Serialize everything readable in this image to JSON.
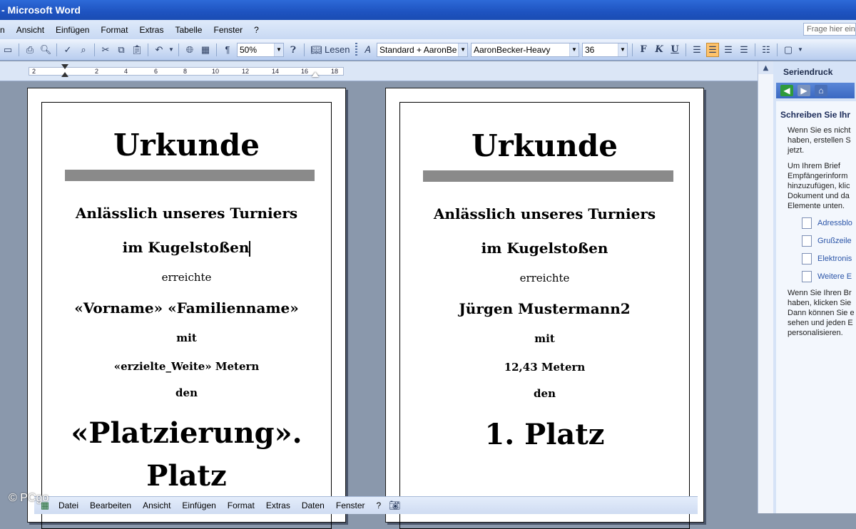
{
  "window": {
    "title": "- Microsoft Word"
  },
  "menu": [
    "n",
    "Ansicht",
    "Einfügen",
    "Format",
    "Extras",
    "Tabelle",
    "Fenster",
    "?"
  ],
  "help_placeholder": "Frage hier ein",
  "toolbar": {
    "zoom": "50%",
    "read_label": "Lesen",
    "style": "Standard + AaronBe",
    "font": "AaronBecker-Heavy",
    "size": "36",
    "bold": "F",
    "italic": "K",
    "underline": "U"
  },
  "ruler": [
    "2",
    "2",
    "4",
    "6",
    "8",
    "10",
    "12",
    "14",
    "16",
    "18"
  ],
  "taskpane": {
    "title": "Seriendruck",
    "heading": "Schreiben Sie Ihr",
    "para1": [
      "Wenn Sie es nicht",
      "haben, erstellen S",
      "jetzt."
    ],
    "para2": [
      "Um Ihrem Brief",
      "Empfängerinform",
      "hinzuzufügen, klic",
      "Dokument und da",
      "Elemente unten."
    ],
    "links": [
      "Adressblo",
      "Grußzeile",
      "Elektronis",
      "Weitere E"
    ],
    "para3": [
      "Wenn Sie Ihren Br",
      "haben, klicken Sie",
      "Dann können Sie e",
      "sehen und jeden E",
      "personalisieren."
    ]
  },
  "pages": [
    {
      "title": "Urkunde",
      "line1": "Anlässlich unseres Turniers",
      "line2": "im Kugelstoßen",
      "line3": "erreichte",
      "name": "«Vorname» «Familienname»",
      "line4": "mit",
      "distance": "«erzielte_Weite» Metern",
      "line5": "den",
      "place_a": "«Platzierung».",
      "place_b": "Platz"
    },
    {
      "title": "Urkunde",
      "line1": "Anlässlich unseres Turniers",
      "line2": "im Kugelstoßen",
      "line3": "erreichte",
      "name": "Jürgen Mustermann2",
      "line4": "mit",
      "distance": "12,43 Metern",
      "line5": "den",
      "place_a": "1. Platz"
    }
  ],
  "bottom_menu": [
    "Datei",
    "Bearbeiten",
    "Ansicht",
    "Einfügen",
    "Format",
    "Extras",
    "Daten",
    "Fenster",
    "?"
  ],
  "watermark": "© PCgo"
}
